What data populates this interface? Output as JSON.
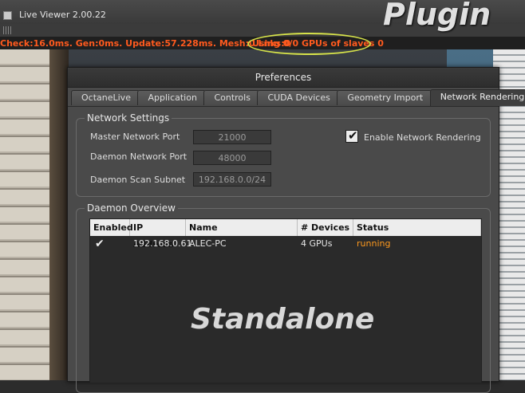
{
  "window": {
    "title": "Live Viewer 2.00.22"
  },
  "statusbar": {
    "stats": "Check:16.0ms. Gen:0ms. Update:57.228ms. Mesh:0 Lnks:0",
    "gpu_status": "Using 0/0 GPUs of slaves 0"
  },
  "annotations": {
    "plugin": "Plugin",
    "standalone": "Standalone"
  },
  "dialog": {
    "title": "Preferences",
    "tabs": [
      "OctaneLive",
      "Application",
      "Controls",
      "CUDA Devices",
      "Geometry Import",
      "Network Rendering"
    ],
    "active_tab": "Network Rendering"
  },
  "network_settings": {
    "title": "Network Settings",
    "master_port_label": "Master Network Port",
    "master_port_value": "21000",
    "daemon_port_label": "Daemon Network Port",
    "daemon_port_value": "48000",
    "scan_subnet_label": "Daemon Scan Subnet",
    "scan_subnet_value": "192.168.0.0/24",
    "enable_label": "Enable Network Rendering",
    "enable_checked": true
  },
  "daemon_overview": {
    "title": "Daemon Overview",
    "columns": [
      "Enabled",
      "IP Address",
      "Name",
      "# Devices",
      "Status"
    ],
    "rows": [
      {
        "enabled": true,
        "ip": "192.168.0.61",
        "name": "ALEC-PC",
        "devices": "4 GPUs",
        "status": "running"
      }
    ]
  },
  "colors": {
    "status_text": "#ff5a1e",
    "running": "#ff9a1e",
    "highlight": "#d6e24a"
  }
}
